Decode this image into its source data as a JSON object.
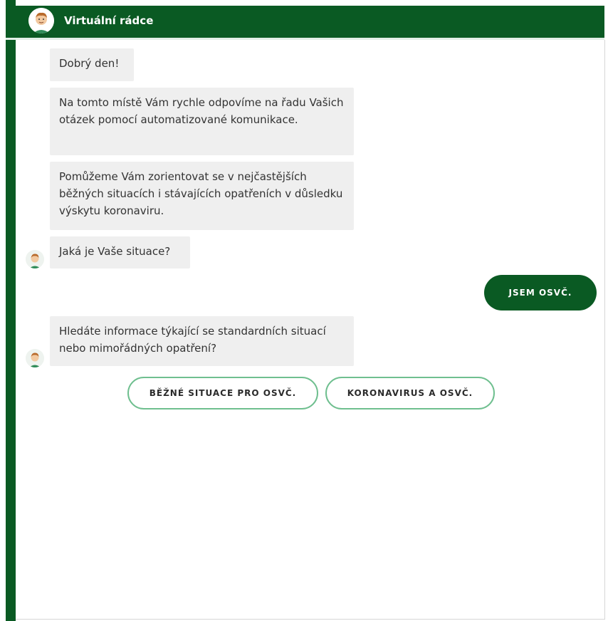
{
  "header": {
    "title": "Virtuální rádce",
    "avatar_icon": "advisor-avatar-icon"
  },
  "messages": [
    {
      "sender": "bot",
      "text": "Dobrý den!"
    },
    {
      "sender": "bot",
      "text": "Na tomto místě Vám rychle odpovíme na řadu Vašich otázek pomocí automatizované komunikace."
    },
    {
      "sender": "bot",
      "text": "Pomůžeme Vám zorientovat se v nejčastějších běžných situacích i stávajících opatřeních v důsledku výskytu koronaviru."
    },
    {
      "sender": "bot",
      "text": "Jaká je Vaše situace?"
    },
    {
      "sender": "user",
      "text": "JSEM OSVČ."
    },
    {
      "sender": "bot",
      "text": "Hledáte informace týkající se standardních situací nebo mimořádných opatření?"
    }
  ],
  "quick_replies": [
    {
      "label": "BĚŽNÉ SITUACE PRO OSVČ."
    },
    {
      "label": "KORONAVIRUS A OSVČ."
    }
  ],
  "colors": {
    "brand_green": "#0a5a23",
    "bubble_gray": "#efefef",
    "option_border": "#6fbf8f"
  }
}
